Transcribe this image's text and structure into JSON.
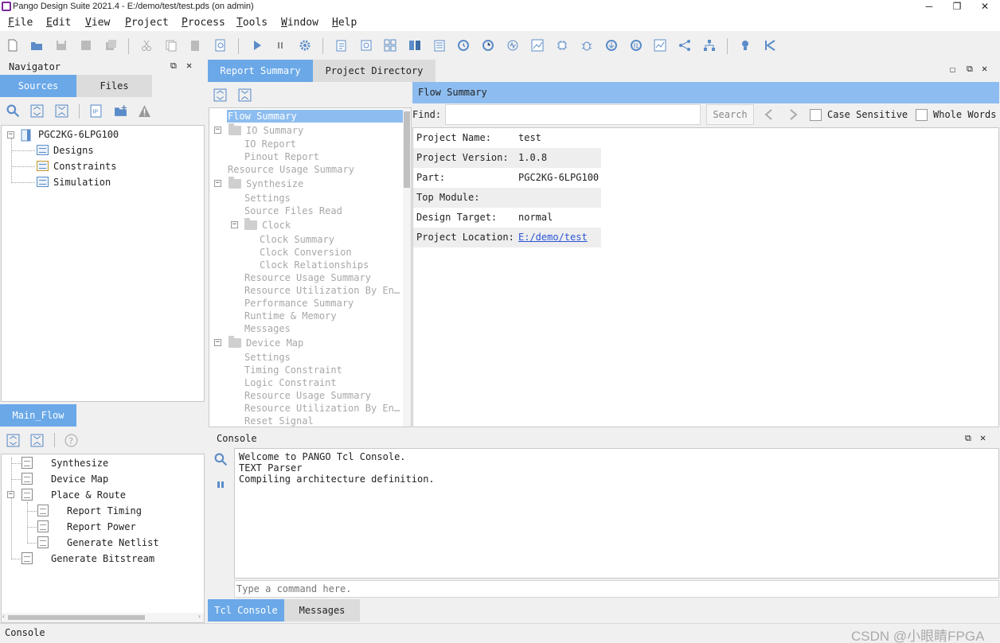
{
  "window": {
    "title": "Pango Design Suite 2021.4 - E:/demo/test/test.pds (on admin)",
    "min": "─",
    "restore": "❐",
    "close": "✕"
  },
  "menu": [
    {
      "u": "F",
      "rest": "ile"
    },
    {
      "u": "E",
      "rest": "dit"
    },
    {
      "u": "V",
      "rest": "iew"
    },
    {
      "u": "P",
      "rest": "roject"
    },
    {
      "u": "P",
      "rest": "rocess"
    },
    {
      "u": "T",
      "rest": "ools"
    },
    {
      "u": "W",
      "rest": "indow"
    },
    {
      "u": "H",
      "rest": "elp"
    }
  ],
  "navigator": {
    "title": "Navigator",
    "tabs": [
      "Sources",
      "Files"
    ],
    "tree": {
      "root": "PGC2KG-6LPG100",
      "children": [
        "Designs",
        "Constraints",
        "Simulation"
      ]
    }
  },
  "main_flow": {
    "tab": "Main_Flow",
    "items": [
      "Synthesize",
      "Device Map",
      "Place & Route",
      "Report Timing",
      "Report Power",
      "Generate Netlist",
      "Generate Bitstream"
    ]
  },
  "report": {
    "tabs": [
      "Report Summary",
      "Project Directory"
    ],
    "tree": [
      "Flow Summary",
      "IO Summary",
      "IO Report",
      "Pinout Report",
      "Resource Usage Summary",
      "Synthesize",
      "Settings",
      "Source Files Read",
      "Clock",
      "Clock Summary",
      "Clock Conversion",
      "Clock Relationships",
      "Resource Usage Summary",
      "Resource Utilization By En…",
      "Performance Summary",
      "Runtime & Memory",
      "Messages",
      "Device Map",
      "Settings",
      "Timing Constraint",
      "Logic Constraint",
      "Resource Usage Summary",
      "Resource Utilization By En…",
      "Reset Signal"
    ],
    "header": "Flow Summary",
    "find_label": "Find:",
    "find_value": "",
    "search_label": "Search",
    "case_sensitive": "Case Sensitive",
    "whole_words": "Whole Words",
    "rows": [
      {
        "label": "Project Name:",
        "value": "test"
      },
      {
        "label": "Project Version:",
        "value": "1.0.8"
      },
      {
        "label": "Part:",
        "value": "PGC2KG-6LPG100"
      },
      {
        "label": "Top Module:",
        "value": ""
      },
      {
        "label": "Design Target:",
        "value": "normal"
      },
      {
        "label": "Project Location:",
        "value": "E:/demo/test"
      }
    ]
  },
  "console": {
    "title": "Console",
    "lines": [
      "Welcome to PANGO Tcl Console.",
      "TEXT Parser",
      "Compiling architecture definition."
    ],
    "placeholder": "Type a command here.",
    "tabs": [
      "Tcl Console",
      "Messages"
    ]
  },
  "statusbar": {
    "text": "Console"
  },
  "watermark": "CSDN @小眼睛FPGA",
  "colors": {
    "accent": "#6aa8e8",
    "selection": "#8dbdf0",
    "link": "#2a55d6"
  }
}
